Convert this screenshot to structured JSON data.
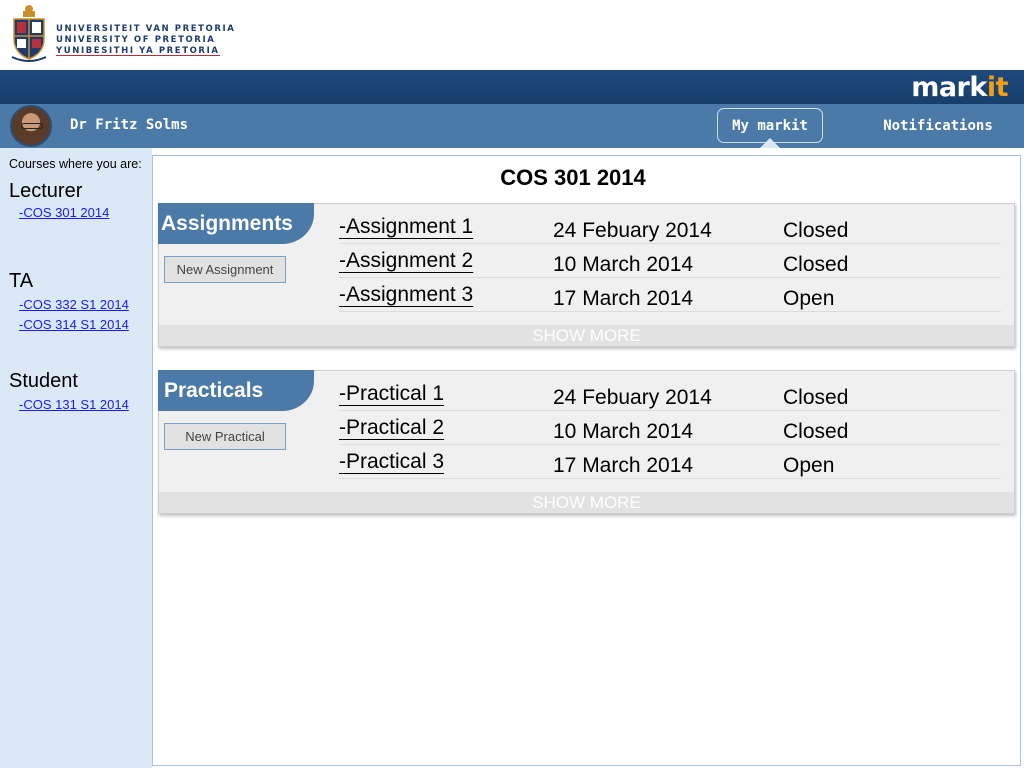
{
  "university": {
    "lines": [
      "UNIVERSITEIT VAN PRETORIA",
      "UNIVERSITY OF PRETORIA",
      "YUNIBESITHI YA PRETORIA"
    ]
  },
  "brand": {
    "name_main": "mark",
    "name_accent": "it",
    "accent_color": "#f2a012"
  },
  "user": {
    "name": "Dr Fritz Solms"
  },
  "nav": {
    "my_markit": "My markit",
    "notifications": "Notifications"
  },
  "sidebar": {
    "intro": "Courses where you are:",
    "roles": [
      {
        "heading": "Lecturer",
        "courses": [
          "-COS 301 2014"
        ]
      },
      {
        "heading": "TA",
        "courses": [
          "-COS 332 S1 2014",
          "-COS 314 S1 2014"
        ]
      },
      {
        "heading": "Student",
        "courses": [
          "-COS 131 S1 2014"
        ]
      }
    ]
  },
  "main": {
    "course_title": "COS 301 2014",
    "sections": [
      {
        "title": "Assignments",
        "button": "New Assignment",
        "items": [
          {
            "name": "-Assignment 1",
            "date": "24 Febuary 2014",
            "status": "Closed"
          },
          {
            "name": "-Assignment 2",
            "date": "10 March 2014",
            "status": "Closed"
          },
          {
            "name": "-Assignment 3",
            "date": "17 March 2014",
            "status": "Open"
          }
        ],
        "show_more": "SHOW MORE"
      },
      {
        "title": "Practicals",
        "button": "New Practical",
        "items": [
          {
            "name": "-Practical 1",
            "date": "24 Febuary 2014",
            "status": "Closed"
          },
          {
            "name": "-Practical 2",
            "date": "10 March 2014",
            "status": "Closed"
          },
          {
            "name": "-Practical 3",
            "date": "17 March 2014",
            "status": "Open"
          }
        ],
        "show_more": "SHOW MORE"
      }
    ]
  },
  "colors": {
    "header_dark": "#1e4a7c",
    "header_mid": "#4b7aa8",
    "sidebar_bg": "#dbe8f5",
    "link": "#1a1aff"
  }
}
